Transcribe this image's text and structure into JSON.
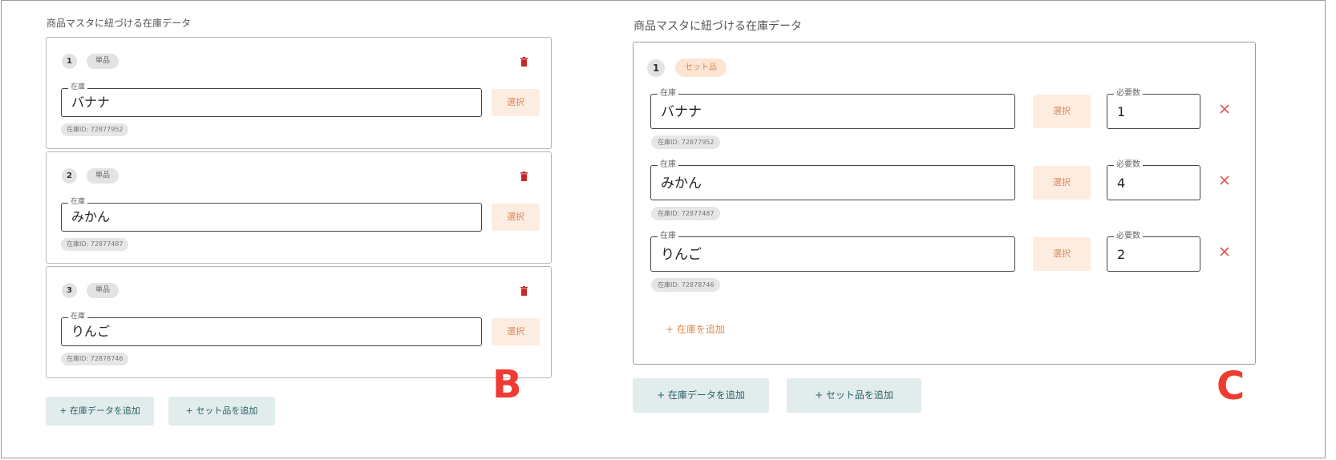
{
  "colors": {
    "accent_orange": "#d88a5c",
    "select_bg": "#fdece0",
    "delete_red": "#c62828",
    "add_button_bg": "#e1eced",
    "add_button_text": "#2d6067",
    "annotation_red": "#ef3b32"
  },
  "panel_b": {
    "title": "商品マスタに紐づける在庫データ",
    "items": [
      {
        "index": "1",
        "type": "単品",
        "field_label": "在庫",
        "value": "バナナ",
        "select_label": "選択",
        "stock_id": "在庫ID: 72877952"
      },
      {
        "index": "2",
        "type": "単品",
        "field_label": "在庫",
        "value": "みかん",
        "select_label": "選択",
        "stock_id": "在庫ID: 72877487"
      },
      {
        "index": "3",
        "type": "単品",
        "field_label": "在庫",
        "value": "りんご",
        "select_label": "選択",
        "stock_id": "在庫ID: 72878746"
      }
    ],
    "add_stock_button": "+ 在庫データを追加",
    "add_set_button": "+ セット品を追加",
    "annotation": "B"
  },
  "panel_c": {
    "title": "商品マスタに紐づける在庫データ",
    "set": {
      "index": "1",
      "type": "セット品",
      "rows": [
        {
          "field_label": "在庫",
          "value": "バナナ",
          "select_label": "選択",
          "qty_label": "必要数",
          "qty": "1",
          "stock_id": "在庫ID: 72877952"
        },
        {
          "field_label": "在庫",
          "value": "みかん",
          "select_label": "選択",
          "qty_label": "必要数",
          "qty": "4",
          "stock_id": "在庫ID: 72877487"
        },
        {
          "field_label": "在庫",
          "value": "りんご",
          "select_label": "選択",
          "qty_label": "必要数",
          "qty": "2",
          "stock_id": "在庫ID: 72878746"
        }
      ],
      "add_stock_link": "+ 在庫を追加"
    },
    "add_stock_button": "+ 在庫データを追加",
    "add_set_button": "+ セット品を追加",
    "annotation": "C"
  }
}
